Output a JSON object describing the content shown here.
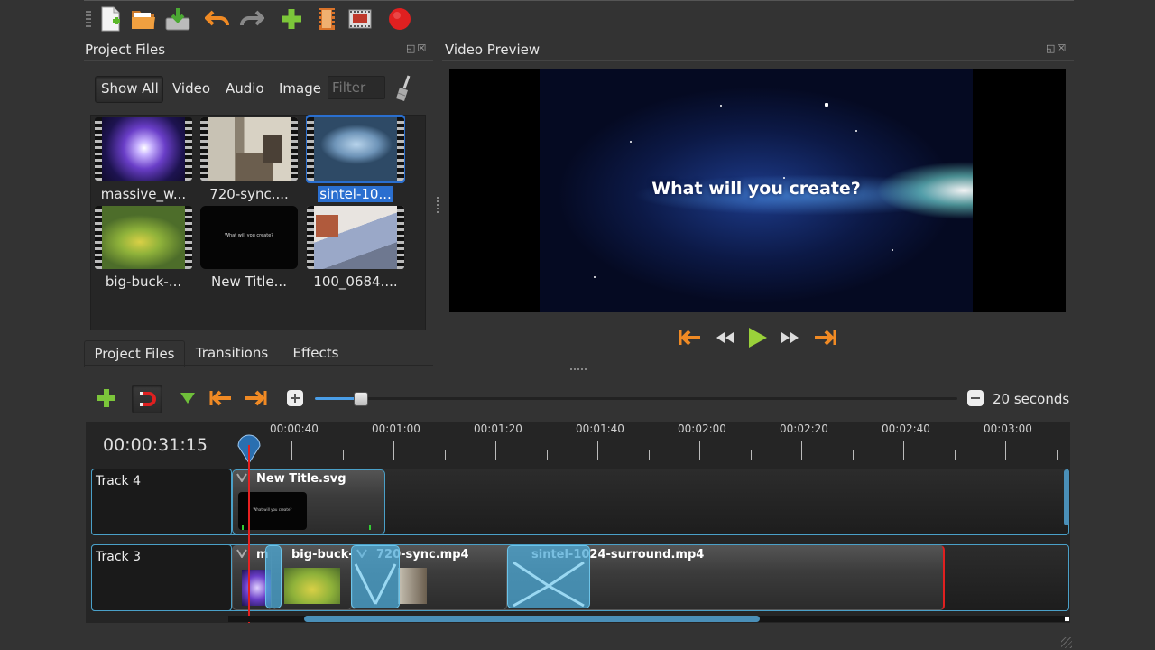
{
  "toolbar": {
    "icons": [
      "new-project-icon",
      "open-project-icon",
      "save-project-icon",
      "undo-icon",
      "redo-icon",
      "import-files-icon",
      "profile-icon",
      "fullscreen-icon",
      "export-video-icon"
    ]
  },
  "project_files_panel": {
    "title": "Project Files",
    "filters": [
      "Show All",
      "Video",
      "Audio",
      "Image"
    ],
    "filter_placeholder": "Filter",
    "files": [
      {
        "label": "massive_w...",
        "selected": false
      },
      {
        "label": "720-sync....",
        "selected": false
      },
      {
        "label": "sintel-10...",
        "selected": true
      },
      {
        "label": "big-buck-...",
        "selected": false
      },
      {
        "label": "New Title...",
        "selected": false,
        "thumb_text": "What will you create?"
      },
      {
        "label": "100_0684....",
        "selected": false
      }
    ],
    "tabs": [
      "Project Files",
      "Transitions",
      "Effects"
    ]
  },
  "video_preview_panel": {
    "title": "Video Preview",
    "overlay_text": "What will you create?"
  },
  "timeline": {
    "zoom_label": "20 seconds",
    "zoom_level": 0.07,
    "timecode": "00:00:31:15",
    "ruler_labels": [
      "00:00:40",
      "00:01:00",
      "00:01:20",
      "00:01:40",
      "00:02:00",
      "00:02:20",
      "00:02:40",
      "00:03:00"
    ],
    "tracks": [
      {
        "name": "Track 4",
        "clips": [
          {
            "name": "New Title.svg",
            "thumb_text": "What will you create?"
          }
        ]
      },
      {
        "name": "Track 3",
        "clips": [
          {
            "name": "m"
          },
          {
            "name": "big-buck-"
          },
          {
            "name": "720-sync.mp4"
          },
          {
            "name": "sintel-1024-surround.mp4"
          }
        ]
      }
    ]
  },
  "colors": {
    "background": "#333333",
    "selection": "#2a6fd0",
    "accent_orange": "#f08a24",
    "accent_green": "#8bd14a",
    "playhead": "#e62020",
    "transition_blue": "#4caad7"
  }
}
